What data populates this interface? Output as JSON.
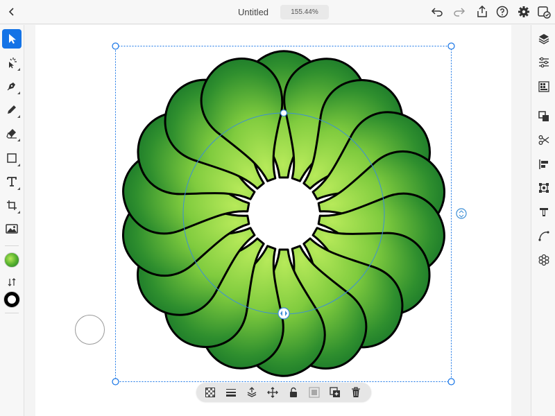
{
  "header": {
    "title": "Untitled",
    "zoom": "155.44%",
    "icons": [
      "back-chevron-icon",
      "undo-icon",
      "redo-icon",
      "share-icon",
      "help-icon",
      "settings-gear-icon",
      "edit-on-desktop-icon"
    ]
  },
  "left_toolbar": {
    "tools": [
      "selection-tool",
      "direct-selection-tool",
      "pen-tool",
      "pencil-tool",
      "eraser-tool",
      "shape-tool",
      "type-tool",
      "crop-rotate-tool",
      "image-place-tool"
    ],
    "active_tool": "selection-tool",
    "fill": "green radial gradient",
    "stroke": "#000000"
  },
  "right_panel": {
    "icons": [
      "layers-icon",
      "properties-icon",
      "swatches-icon",
      "pathfinder-icon",
      "scissors-icon",
      "align-icon",
      "transform-icon",
      "type-icon",
      "curvature-icon",
      "pattern-icon"
    ]
  },
  "canvas": {
    "artwork": "radial repeat of green gradient petals",
    "petal_count": 18,
    "colors": {
      "petal_light": "#b7ea5a",
      "petal_mid": "#58b22f",
      "petal_dark": "#1c7a2a",
      "outline": "#000000",
      "selection": "#1473e6",
      "guide": "#3d8fd6"
    }
  },
  "context_bar": {
    "icons": [
      "transparency-icon",
      "stroke-weight-icon",
      "arrange-icon",
      "move-icon",
      "lock-icon",
      "group-icon",
      "duplicate-icon",
      "delete-icon"
    ]
  }
}
